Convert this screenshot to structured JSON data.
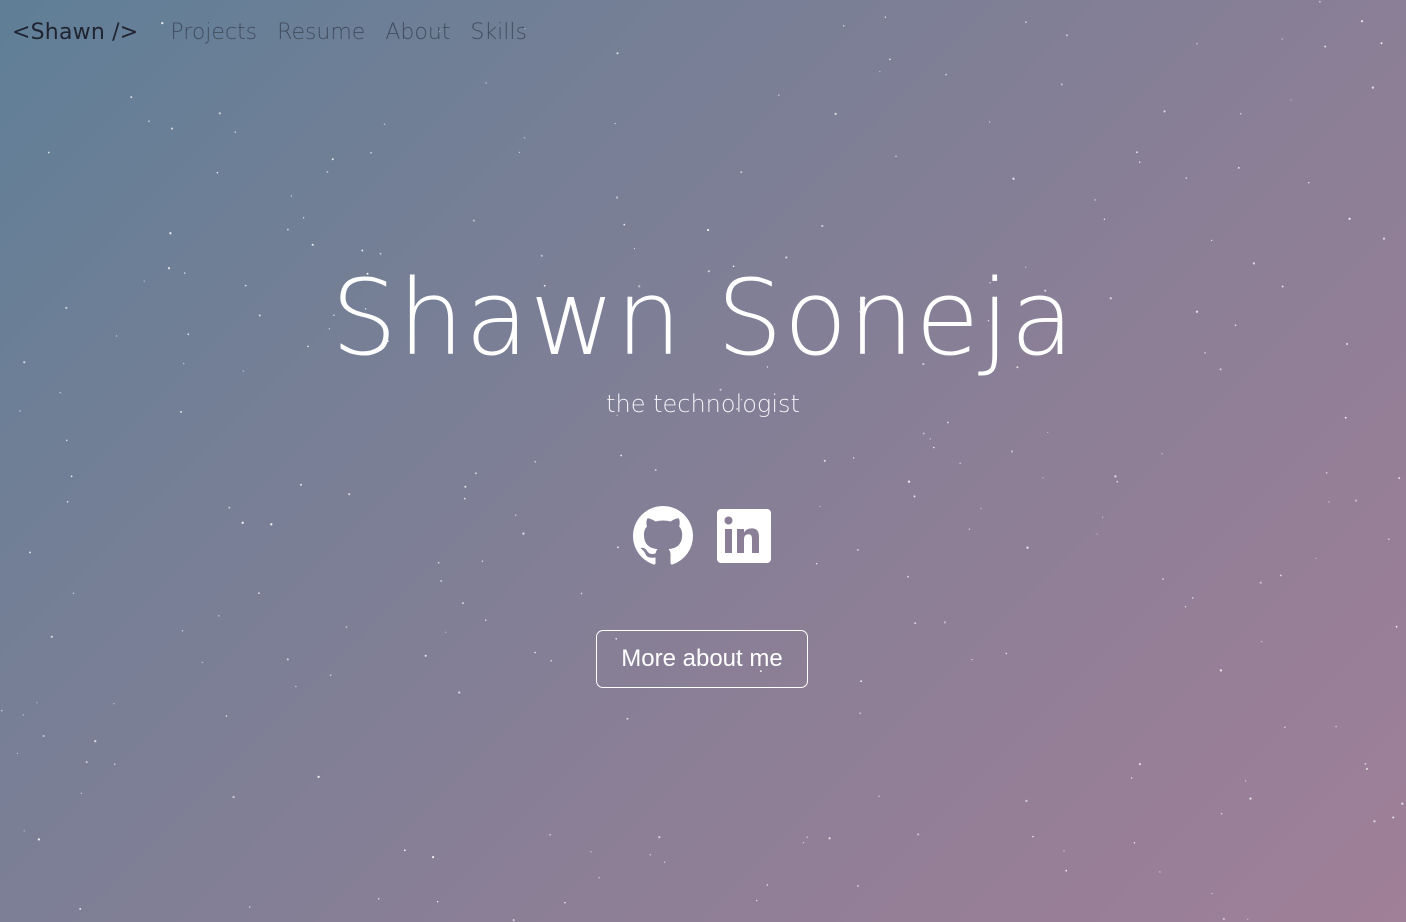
{
  "nav": {
    "brand": "<Shawn />",
    "links": [
      "Projects",
      "Resume",
      "About",
      "Skills"
    ]
  },
  "hero": {
    "name": "Shawn Soneja",
    "tagline": "the technologist"
  },
  "socials": [
    {
      "icon": "github-icon"
    },
    {
      "icon": "linkedin-icon"
    }
  ],
  "cta": {
    "label": "More about me"
  },
  "colors": {
    "gradient_start": "#5f7f97",
    "gradient_end": "#a07f98",
    "brand_text": "#1f2430",
    "nav_text": "#3b4456",
    "hero_text": "#ffffff"
  }
}
